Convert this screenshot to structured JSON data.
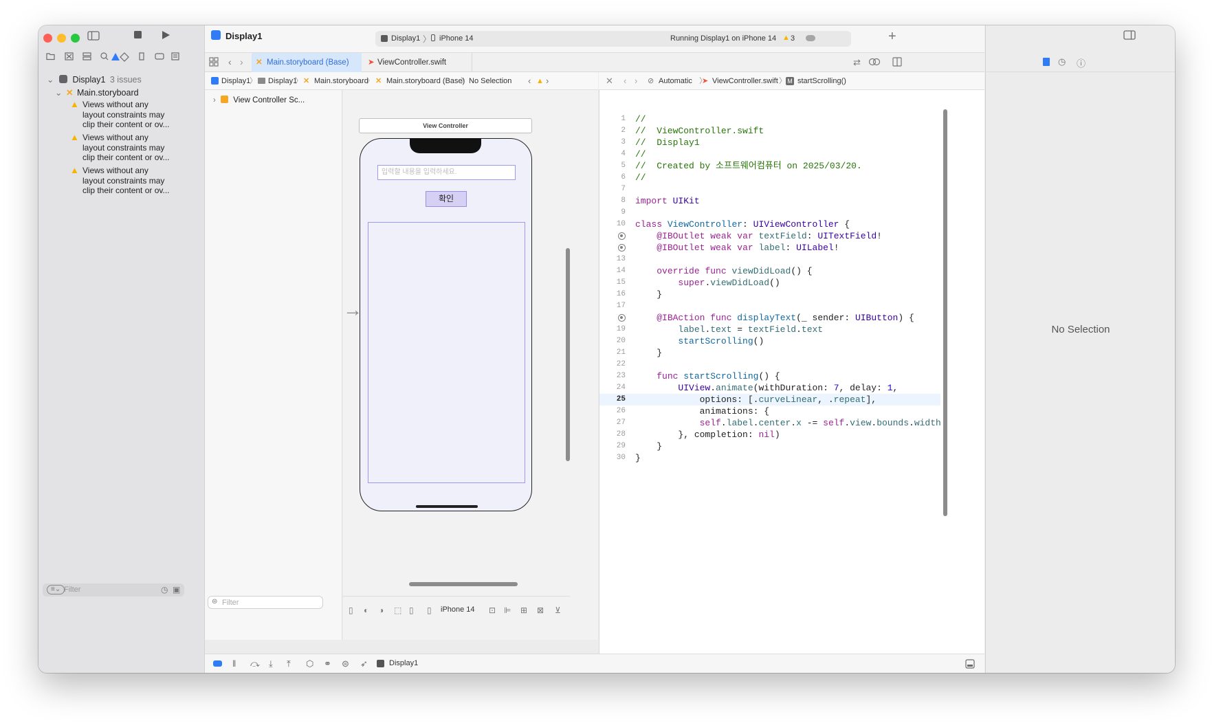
{
  "window": {
    "project_title": "Display1"
  },
  "toolbar": {
    "scheme_target": "Display1",
    "scheme_device": "iPhone 14",
    "status_text": "Running Display1 on iPhone 14",
    "warning_count": "3"
  },
  "navigator": {
    "project_name": "Display1",
    "issue_count": "3 issues",
    "file_name": "Main.storyboard",
    "issues": [
      {
        "line1": "Views without any",
        "line2": "layout constraints may",
        "line3": "clip their content or ov..."
      },
      {
        "line1": "Views without any",
        "line2": "layout constraints may",
        "line3": "clip their content or ov..."
      },
      {
        "line1": "Views without any",
        "line2": "layout constraints may",
        "line3": "clip their content or ov..."
      }
    ],
    "filter_placeholder": "Filter"
  },
  "tabs": [
    {
      "label": "Main.storyboard (Base)",
      "active": true
    },
    {
      "label": "ViewController.swift",
      "active": false
    }
  ],
  "breadcrumb_left": [
    "Display1",
    "Display1",
    "Main.storyboard",
    "Main.storyboard (Base)",
    "No Selection"
  ],
  "breadcrumb_right": [
    "Automatic",
    "ViewController.swift",
    "startScrolling()"
  ],
  "outline": {
    "item": "View Controller Sc...",
    "filter_placeholder": "Filter"
  },
  "canvas": {
    "scene_title": "View Controller",
    "textfield_placeholder": "입력할 내용을 입력하세요.",
    "button_label": "확인",
    "device_label": "iPhone 14"
  },
  "code": {
    "current_line": 25,
    "breakpoint_lines": [
      11,
      12,
      18
    ],
    "lines": [
      "//",
      "//  ViewController.swift",
      "//  Display1",
      "//",
      "//  Created by 소프트웨어컴퓨터 on 2025/03/20.",
      "//",
      "",
      "import UIKit",
      "",
      "class ViewController: UIViewController {",
      "    @IBOutlet weak var textField: UITextField!",
      "    @IBOutlet weak var label: UILabel!",
      "",
      "    override func viewDidLoad() {",
      "        super.viewDidLoad()",
      "    }",
      "",
      "    @IBAction func displayText(_ sender: UIButton) {",
      "        label.text = textField.text",
      "        startScrolling()",
      "    }",
      "",
      "    func startScrolling() {",
      "        UIView.animate(withDuration: 7, delay: 1,",
      "            options: [.curveLinear, .repeat],",
      "            animations: {",
      "            self.label.center.x -= self.view.bounds.width",
      "        }, completion: nil)",
      "    }",
      "}"
    ]
  },
  "inspector": {
    "empty_text": "No Selection"
  },
  "debug_bar": {
    "target": "Display1"
  },
  "colors": {
    "accent": "#2f7cf6",
    "warning": "#f5b400",
    "breakpoint": "#7f7f7f"
  }
}
